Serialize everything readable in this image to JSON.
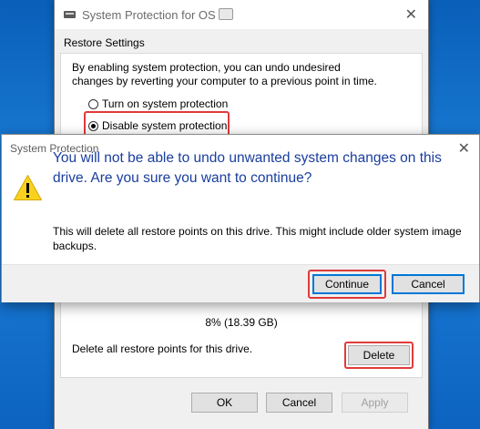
{
  "bg_window": {
    "title": "System Protection for OS",
    "close_glyph": "✕",
    "tab_label": "Restore Settings",
    "description": "By enabling system protection, you can undo undesired changes by reverting your computer to a previous point in time.",
    "radio_on_label": "Turn on system protection",
    "radio_off_label": "Disable system protection",
    "radio_selected": "Disable system protection",
    "usage_text": "8% (18.39 GB)",
    "delete_text": "Delete all restore points for this drive.",
    "delete_label": "Delete",
    "ok_label": "OK",
    "cancel_label": "Cancel",
    "apply_label": "Apply"
  },
  "dialog": {
    "title": "System Protection",
    "close_glyph": "✕",
    "icon": "warning-icon",
    "main_text": "You will not be able to undo unwanted system changes on this drive. Are you sure you want to continue?",
    "sub_text": "This will delete all restore points on this drive. This might include older system image backups.",
    "continue_label": "Continue",
    "cancel_label": "Cancel"
  },
  "colors": {
    "highlight": "#e03a3a",
    "dialog_heading": "#1a3e9e",
    "focus_border": "#0078d7",
    "warning_fill": "#f9d21f"
  }
}
